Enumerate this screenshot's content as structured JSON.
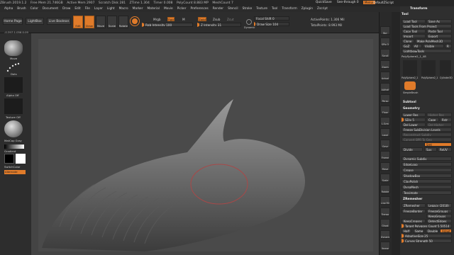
{
  "titlebar": {
    "app": "ZBrush 2019.1.2",
    "free_mem": "Free Mem 21.746GB",
    "active_mem": "Active Mem 2907",
    "scratch_disk": "Scratch Disk 281",
    "ztime": "ZTime 1.304",
    "timer": "Timer 0.008",
    "polycount": "PolyCount 8.883 MP",
    "meshcount": "MeshCount 7",
    "quicksave": "QuickSave",
    "seethrough": "See-through 0",
    "menus": "Menus",
    "script": "DefaultZScript"
  },
  "menubar": [
    "Alpha",
    "Brush",
    "Color",
    "Document",
    "Draw",
    "Edit",
    "File",
    "Layer",
    "Light",
    "Macro",
    "Marker",
    "Material",
    "Movie",
    "Picker",
    "Preferences",
    "Render",
    "Stencil",
    "Stroke",
    "Texture",
    "Tool",
    "Transform",
    "Zplugin",
    "Zscript"
  ],
  "shelf": {
    "home": "Home Page",
    "lightbox": "LightBox",
    "live_boolean": "Live Boolean",
    "edit": "Edit",
    "draw": "Draw",
    "move": "Move",
    "scale": "Scale",
    "rotate": "Rotate",
    "mrgb": "Mrgb",
    "rgb": "Rgb",
    "m": "M",
    "zadd": "Zadd",
    "zsub": "Zsub",
    "zcut": "Zcut",
    "rgb_intensity_label": "Rgb Intensity",
    "rgb_intensity": "100",
    "z_intensity_label": "Z Intensity",
    "z_intensity": "31",
    "focal_shift_label": "Focal Shift",
    "focal_shift": "0",
    "draw_size_label": "Draw Size",
    "draw_size": "104",
    "dynamic": "Dynamic",
    "active_points": "ActivePoints: 1.306 Mil",
    "total_points": "TotalPoints: 8.993 Mil"
  },
  "coords": "-0.397,1.056,0.09",
  "left": {
    "standard": "Move",
    "dots": "Dots",
    "alpha": "Alpha Off",
    "texture": "Texture Off",
    "matcap": "MatCap Gray",
    "gradient": "Gradient",
    "switch_color": "SwitchColor",
    "alternate": "Alternate"
  },
  "right_shelf": [
    "Bpr",
    "SPix 3",
    "Scroll",
    "Zoom",
    "Actual",
    "AAHalf",
    "Persp",
    "Floor",
    "L.Sym",
    "Local",
    "Gxyz",
    "Frame",
    "Move",
    "Scale",
    "Rotate",
    "Line Fill PolyF",
    "Transp",
    "Ghost",
    "Dynamic Solo",
    "Xpose"
  ],
  "panel": {
    "header": "Transform",
    "tool": "Tool",
    "load_tool": "Load Tool",
    "save_as": "Save As",
    "load_project": "Load Tools From Project",
    "copy_tool": "Copy Tool",
    "paste_tool": "Paste Tool",
    "import": "Import",
    "export": "Export",
    "clone": "Clone",
    "make_polymesh": "Make PolyMesh3D",
    "goz": "GoZ",
    "all": "All",
    "visible": "Visible",
    "r": "R",
    "lightbox_tools": "Lightbox▸Tools",
    "polysphere_label": "PolySphere2_1_48",
    "thumbs": [
      "PolySphere2_1",
      "PolySphere2_1",
      "Cylinder3D",
      "SimpleBrush"
    ],
    "subtool": "Subtool",
    "geometry": "Geometry",
    "lower_res": "Lower Res",
    "higher_res": "Higher Res",
    "sdiv": "SDiv 5",
    "cage": "Cage",
    "rstr": "Rstr",
    "del_lower": "Del Lower",
    "del_higher": "Del Higher",
    "freeze": "Freeze SubDivision Levels",
    "reconstruct": "Reconstruct Subdiv",
    "convert_bpr": "Convert BPR To Geo",
    "divide": "Divide",
    "smt": "Smt",
    "suv": "Suv",
    "reuv": "ReUV",
    "dynamic_subdiv": "Dynamic Subdiv",
    "edgeloop": "EdgeLoop",
    "crease": "Crease",
    "shadowbox": "ShadowBox",
    "claypolish": "ClayPolish",
    "dynamesh": "DynaMesh",
    "tessimate": "Tessimate",
    "zremesher_section": "ZRemesher",
    "zremesher": "ZRemesher",
    "legacy": "Legacy (2018)",
    "freeze_border": "FreezeBorder",
    "freeze_groups": "FreezeGroups",
    "keep_groups": "KeepGroups",
    "keep_creases": "KeepCreases",
    "detect_edges": "DetectEdges",
    "target_poly": "Target Polygons Count 5.50514",
    "half": "Half",
    "same": "Same",
    "double": "Double",
    "adapt": "Adapt",
    "adaptive_size": "AdaptiveSize 25",
    "curves_strength": "Curves Strength 50"
  }
}
